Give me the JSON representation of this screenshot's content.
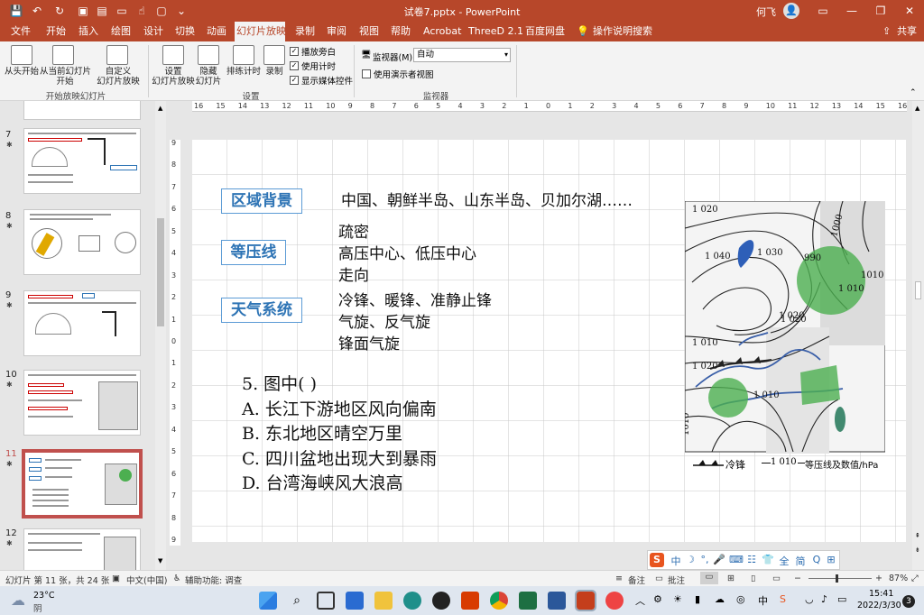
{
  "window": {
    "title": "试卷7.pptx  -  PowerPoint",
    "user": "何飞",
    "quick_access": [
      "save-icon",
      "undo-icon",
      "redo-icon",
      "start-icon",
      "folder-icon",
      "camera-icon",
      "touch-icon",
      "new-icon",
      "more-icon"
    ]
  },
  "menu": {
    "tabs": [
      "文件",
      "开始",
      "插入",
      "绘图",
      "设计",
      "切换",
      "动画",
      "幻灯片放映",
      "录制",
      "审阅",
      "视图",
      "帮助",
      "Acrobat",
      "ThreeD 2.1",
      "百度网盘"
    ],
    "active": "幻灯片放映",
    "tell_me": "操作说明搜索",
    "share": "共享"
  },
  "ribbon": {
    "start": {
      "from_beginning": "从头开始",
      "from_current_1": "从当前幻灯片",
      "from_current_2": "开始",
      "custom_1": "自定义",
      "custom_2": "幻灯片放映",
      "group": "开始放映幻灯片"
    },
    "setup": {
      "setup_1": "设置",
      "setup_2": "幻灯片放映",
      "hide_1": "隐藏",
      "hide_2": "幻灯片",
      "rehearse": "排练计时",
      "record": "录制",
      "play_narrations": "播放旁白",
      "use_timings": "使用计时",
      "show_media": "显示媒体控件",
      "group": "设置"
    },
    "monitors": {
      "monitor_label": "监视器(M):",
      "monitor_value": "自动",
      "presenter_view": "使用演示者视图",
      "group": "监视器"
    }
  },
  "thumbnails": [
    {
      "num": "7",
      "star": "✱"
    },
    {
      "num": "8",
      "star": "✱"
    },
    {
      "num": "9",
      "star": "✱"
    },
    {
      "num": "10",
      "star": "✱"
    },
    {
      "num": "11",
      "star": "✱"
    },
    {
      "num": "12",
      "star": "✱"
    }
  ],
  "ruler": {
    "h": [
      "16",
      "15",
      "14",
      "13",
      "12",
      "11",
      "10",
      "9",
      "8",
      "7",
      "6",
      "5",
      "4",
      "3",
      "2",
      "1",
      "0",
      "1",
      "2",
      "3",
      "4",
      "5",
      "6",
      "7",
      "8",
      "9",
      "10",
      "11",
      "12",
      "13",
      "14",
      "15",
      "16"
    ],
    "v": [
      "9",
      "8",
      "7",
      "6",
      "5",
      "4",
      "3",
      "2",
      "1",
      "0",
      "1",
      "2",
      "3",
      "4",
      "5",
      "6",
      "7",
      "8",
      "9"
    ]
  },
  "slide": {
    "labels": {
      "region": "区域背景",
      "isobar": "等压线",
      "weather": "天气系统"
    },
    "region_text": "中国、朝鲜半岛、山东半岛、贝加尔湖……",
    "isobar_lines": [
      "疏密",
      "高压中心、低压中心",
      "走向"
    ],
    "weather_lines": [
      "冷锋、暖锋、准静止锋",
      "气旋、反气旋",
      "锋面气旋"
    ],
    "question": {
      "stem": "5. 图中(        )",
      "options": [
        "A. 长江下游地区风向偏南",
        "B. 东北地区晴空万里",
        "C. 四川盆地出现大到暴雨",
        "D. 台湾海峡风大浪高"
      ]
    },
    "map": {
      "isobar_values": [
        "1 020",
        "1 040",
        "1 030",
        "1 020",
        "1 010",
        "1 020",
        "1 010",
        "1 020",
        "1010",
        "990",
        "1 010",
        "1000",
        "1010"
      ],
      "legend_front": "冷锋",
      "legend_isobar_value": "1 010",
      "legend_isobar_text": "等压线及数值/hPa",
      "highlight_color": "#4caf50"
    }
  },
  "ime": [
    "中",
    "☽",
    "°,",
    "🎤",
    "⌨",
    "☷",
    "👕",
    "全",
    "简",
    "Q",
    "⊞"
  ],
  "status": {
    "slide_info": "幻灯片 第 11 张，共 24 张",
    "language": "中文(中国)",
    "accessibility": "辅助功能: 调查",
    "notes": "备注",
    "comments": "批注",
    "zoom": "87%"
  },
  "taskbar": {
    "temp": "23°C",
    "weather": "阴",
    "time": "15:41",
    "date": "2022/3/30",
    "notif_count": "3"
  },
  "colors": {
    "accent": "#b7472a",
    "keyword_border": "#5b9bd5",
    "keyword_text": "#2e74b5"
  }
}
